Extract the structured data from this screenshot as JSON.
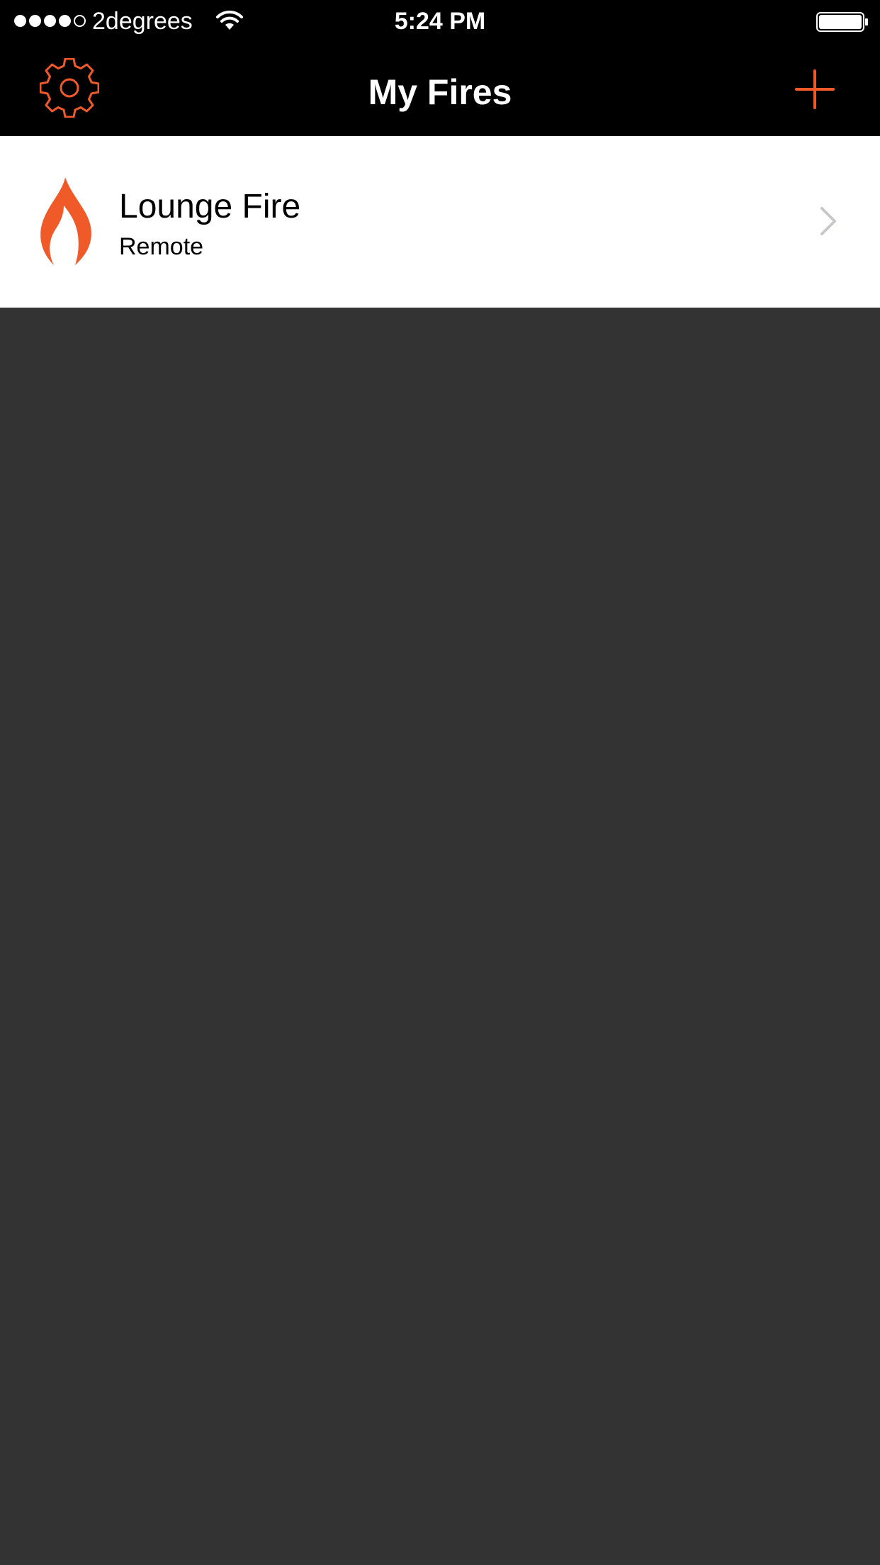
{
  "status_bar": {
    "carrier": "2degrees",
    "time": "5:24 PM",
    "signal_bars_filled": 4,
    "signal_bars_total": 5
  },
  "nav": {
    "title": "My Fires",
    "settings_icon": "gear-icon",
    "add_icon": "plus-icon"
  },
  "fires": [
    {
      "name": "Lounge Fire",
      "mode": "Remote",
      "icon": "flame-icon"
    }
  ],
  "colors": {
    "accent": "#F05A28",
    "nav_background": "#000000",
    "list_background": "#FFFFFF",
    "page_background": "#333333",
    "chevron": "#C7C7CC"
  }
}
